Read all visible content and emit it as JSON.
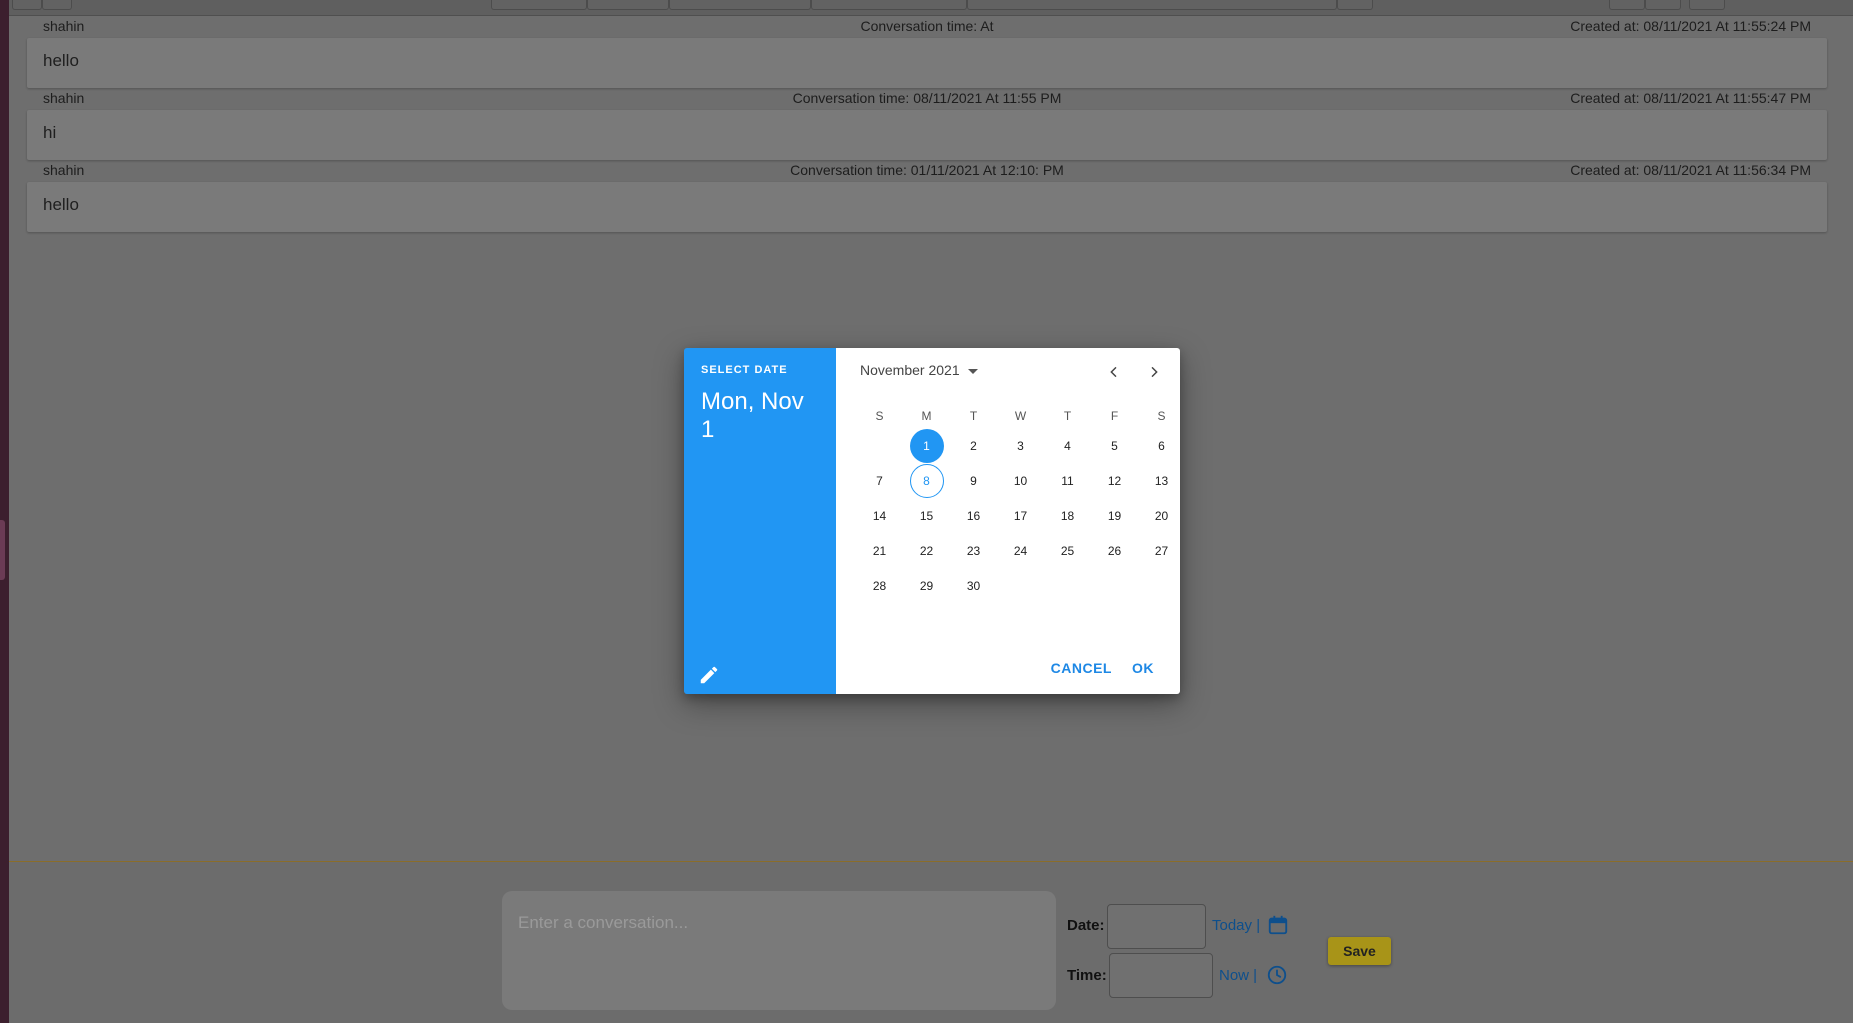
{
  "conversations": [
    {
      "author": "shahin",
      "conversation_time": "Conversation time:  At",
      "created_at": "Created at: 08/11/2021 At 11:55:24 PM",
      "text": "hello"
    },
    {
      "author": "shahin",
      "conversation_time": "Conversation time: 08/11/2021 At 11:55 PM",
      "created_at": "Created at: 08/11/2021 At 11:55:47 PM",
      "text": "hi"
    },
    {
      "author": "shahin",
      "conversation_time": "Conversation time: 01/11/2021 At 12:10: PM",
      "created_at": "Created at: 08/11/2021 At 11:56:34 PM",
      "text": "hello"
    }
  ],
  "composer": {
    "placeholder": "Enter a conversation...",
    "date_label": "Date:",
    "time_label": "Time:",
    "today_link": "Today |",
    "now_link": "Now |",
    "save_label": "Save",
    "calendar_icon": "calendar-icon",
    "clock_icon": "clock-icon"
  },
  "date_picker": {
    "overline": "SELECT DATE",
    "selected_label": "Mon, Nov 1",
    "month_label": "November 2021",
    "weekdays": [
      "S",
      "M",
      "T",
      "W",
      "T",
      "F",
      "S"
    ],
    "weeks": [
      [
        "",
        "1",
        "2",
        "3",
        "4",
        "5",
        "6"
      ],
      [
        "7",
        "8",
        "9",
        "10",
        "11",
        "12",
        "13"
      ],
      [
        "14",
        "15",
        "16",
        "17",
        "18",
        "19",
        "20"
      ],
      [
        "21",
        "22",
        "23",
        "24",
        "25",
        "26",
        "27"
      ],
      [
        "28",
        "29",
        "30",
        "",
        "",
        "",
        ""
      ]
    ],
    "selected_day": "1",
    "today_day": "8",
    "cancel_label": "CANCEL",
    "ok_label": "OK",
    "accent_color": "#2196f3"
  }
}
